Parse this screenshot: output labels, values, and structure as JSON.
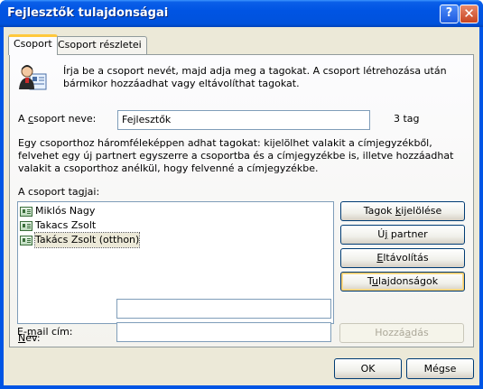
{
  "window": {
    "title": "Fejlesztők tulajdonságai",
    "help_glyph": "?",
    "close_glyph": "✕"
  },
  "tabs": [
    {
      "label": "Csoport"
    },
    {
      "label": "Csoport részletei"
    }
  ],
  "intro": {
    "icon": "group-contacts-icon",
    "text": "Írja be a csoport nevét, majd adja meg a tagokat. A csoport létrehozása után bármikor hozzáadhat vagy eltávolíthat tagokat."
  },
  "group_name": {
    "label_pre": "A ",
    "label_key": "c",
    "label_post": "soport neve:",
    "value": "Fejlesztők",
    "count": "3 tag"
  },
  "help_text": "Egy csoporthoz háromféleképpen adhat tagokat: kijelölhet valakit a címjegyzékből, felvehet egy új partnert egyszerre a csoportba és a címjegyzékbe is, illetve hozzáadhat valakit a csoporthoz anélkül, hogy felvenné a címjegyzékbe.",
  "members": {
    "label_pre": "A csoport ta",
    "label_key": "g",
    "label_post": "jai:",
    "items": [
      {
        "name": "Miklós Nagy"
      },
      {
        "name": "Takacs Zsolt"
      },
      {
        "name": "Takács Zsolt (otthon)"
      }
    ]
  },
  "buttons": {
    "select_pre": "Tagok ",
    "select_key": "k",
    "select_post": "ijelölése",
    "new_pre": "Ú",
    "new_key": "j",
    "new_post": " partner",
    "remove_pre": "",
    "remove_key": "E",
    "remove_post": "ltávolítás",
    "props_pre": "T",
    "props_key": "u",
    "props_post": "lajdonságok",
    "add_pre": "Hozzá",
    "add_key": "a",
    "add_post": "dás",
    "ok": "OK",
    "cancel": "Mégse"
  },
  "name_field": {
    "label_pre": "",
    "label_key": "N",
    "label_post": "év:",
    "value": ""
  },
  "email_field": {
    "label_pre": "E-",
    "label_key": "m",
    "label_post": "ail cím:",
    "value": ""
  },
  "colors": {
    "title_bar": "#0054E3",
    "dialog_bg": "#ECE9D8",
    "tab_highlight": "#FFC83C"
  }
}
